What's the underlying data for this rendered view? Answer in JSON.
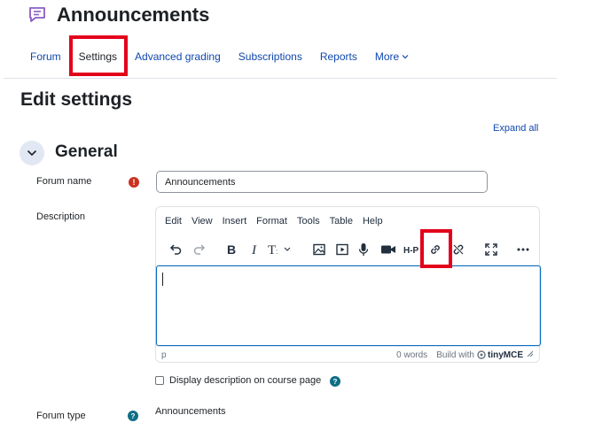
{
  "header": {
    "title": "Announcements",
    "icon": "forum-icon"
  },
  "tabs": [
    {
      "label": "Forum",
      "active": false
    },
    {
      "label": "Settings",
      "active": true
    },
    {
      "label": "Advanced grading",
      "active": false
    },
    {
      "label": "Subscriptions",
      "active": false
    },
    {
      "label": "Reports",
      "active": false
    },
    {
      "label": "More",
      "active": false
    }
  ],
  "main": {
    "title": "Edit settings",
    "expand_all": "Expand all",
    "section_title": "General"
  },
  "form": {
    "forum_name_label": "Forum name",
    "forum_name_value": "Announcements",
    "description_label": "Description",
    "display_description_label": "Display description on course page",
    "forum_type_label": "Forum type",
    "forum_type_value": "Announcements"
  },
  "editor": {
    "menu": [
      "Edit",
      "View",
      "Insert",
      "Format",
      "Tools",
      "Table",
      "Help"
    ],
    "toolbar": [
      "undo-icon",
      "redo-icon",
      "bold-icon",
      "italic-icon",
      "text-style-icon",
      "image-icon",
      "media-icon",
      "microphone-icon",
      "video-camera-icon",
      "h5p-icon",
      "link-icon",
      "unlink-icon",
      "fullscreen-icon",
      "more-icon"
    ],
    "status_path": "p",
    "word_count": "0 words",
    "build_with": "Build with",
    "brand": "tinyMCE"
  },
  "colors": {
    "link": "#0f47ad",
    "highlight": "#e3001b",
    "required": "#ca3120",
    "help": "#0f6e84",
    "focus": "#0f6cbf"
  }
}
